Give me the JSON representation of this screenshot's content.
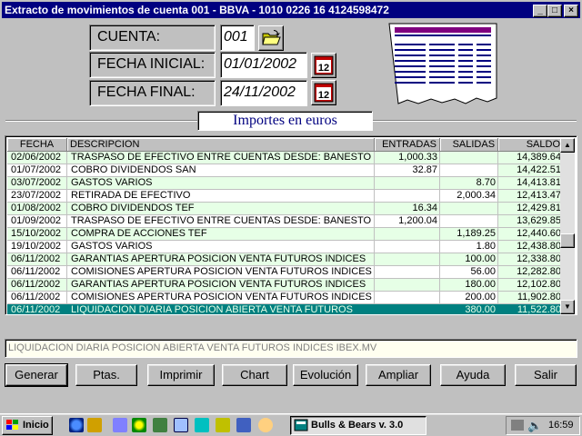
{
  "window": {
    "title": "Extracto de movimientos de cuenta 001 - BBVA - 1010 0226 16 4124598472",
    "minimize_glyph": "_",
    "maximize_glyph": "□",
    "close_glyph": "×"
  },
  "form": {
    "cuenta_label": "CUENTA:",
    "cuenta_value": "001",
    "fecha_inicial_label": "FECHA INICIAL:",
    "fecha_inicial_value": "01/01/2002",
    "fecha_final_label": "FECHA FINAL:",
    "fecha_final_value": "24/11/2002",
    "calendar_glyph": "12"
  },
  "section_title": "Importes en euros",
  "grid": {
    "columns": [
      "FECHA",
      "DESCRIPCION",
      "ENTRADAS",
      "SALIDAS",
      "SALDO"
    ],
    "rows": [
      [
        "02/06/2002",
        "TRASPASO DE EFECTIVO ENTRE CUENTAS DESDE: BANESTO",
        "1,000.33",
        "",
        "14,389.64"
      ],
      [
        "01/07/2002",
        "COBRO DIVIDENDOS SAN",
        "32.87",
        "",
        "14,422.51"
      ],
      [
        "03/07/2002",
        "GASTOS VARIOS",
        "",
        "8.70",
        "14,413.81"
      ],
      [
        "23/07/2002",
        "RETIRADA DE EFECTIVO",
        "",
        "2,000.34",
        "12,413.47"
      ],
      [
        "01/08/2002",
        "COBRO DIVIDENDOS TEF",
        "16.34",
        "",
        "12,429.81"
      ],
      [
        "01/09/2002",
        "TRASPASO DE EFECTIVO ENTRE CUENTAS DESDE: BANESTO",
        "1,200.04",
        "",
        "13,629.85"
      ],
      [
        "15/10/2002",
        "COMPRA DE ACCIONES TEF",
        "",
        "1,189.25",
        "12,440.60"
      ],
      [
        "19/10/2002",
        "GASTOS VARIOS",
        "",
        "1.80",
        "12,438.80"
      ],
      [
        "06/11/2002",
        "GARANTIAS APERTURA POSICION VENTA FUTUROS INDICES",
        "",
        "100.00",
        "12,338.80"
      ],
      [
        "06/11/2002",
        "COMISIONES APERTURA POSICION VENTA FUTUROS INDICES",
        "",
        "56.00",
        "12,282.80"
      ],
      [
        "06/11/2002",
        "GARANTIAS APERTURA POSICION VENTA FUTUROS INDICES",
        "",
        "180.00",
        "12,102.80"
      ],
      [
        "06/11/2002",
        "COMISIONES APERTURA POSICION VENTA FUTUROS INDICES",
        "",
        "200.00",
        "11,902.80"
      ],
      [
        "06/11/2002",
        "LIQUIDACION DIARIA POSICION ABIERTA VENTA FUTUROS",
        "",
        "380.00",
        "11,522.80"
      ]
    ],
    "selected_row": 12
  },
  "description_text": "LIQUIDACION DIARIA POSICION ABIERTA VENTA FUTUROS INDICES IBEX.MV",
  "buttons": {
    "generar": "Generar",
    "ptas": "Ptas.",
    "imprimir": "Imprimir",
    "chart": "Chart",
    "evolucion": "Evolución",
    "ampliar": "Ampliar",
    "ayuda": "Ayuda",
    "salir": "Salir"
  },
  "taskbar": {
    "start_label": "Inicio",
    "task_label": "Bulls & Bears v. 3.0",
    "clock": "16:59"
  },
  "colors": {
    "title_bar": "#000080",
    "row_alt": "#e6ffe6",
    "selected_row": "#008080"
  }
}
